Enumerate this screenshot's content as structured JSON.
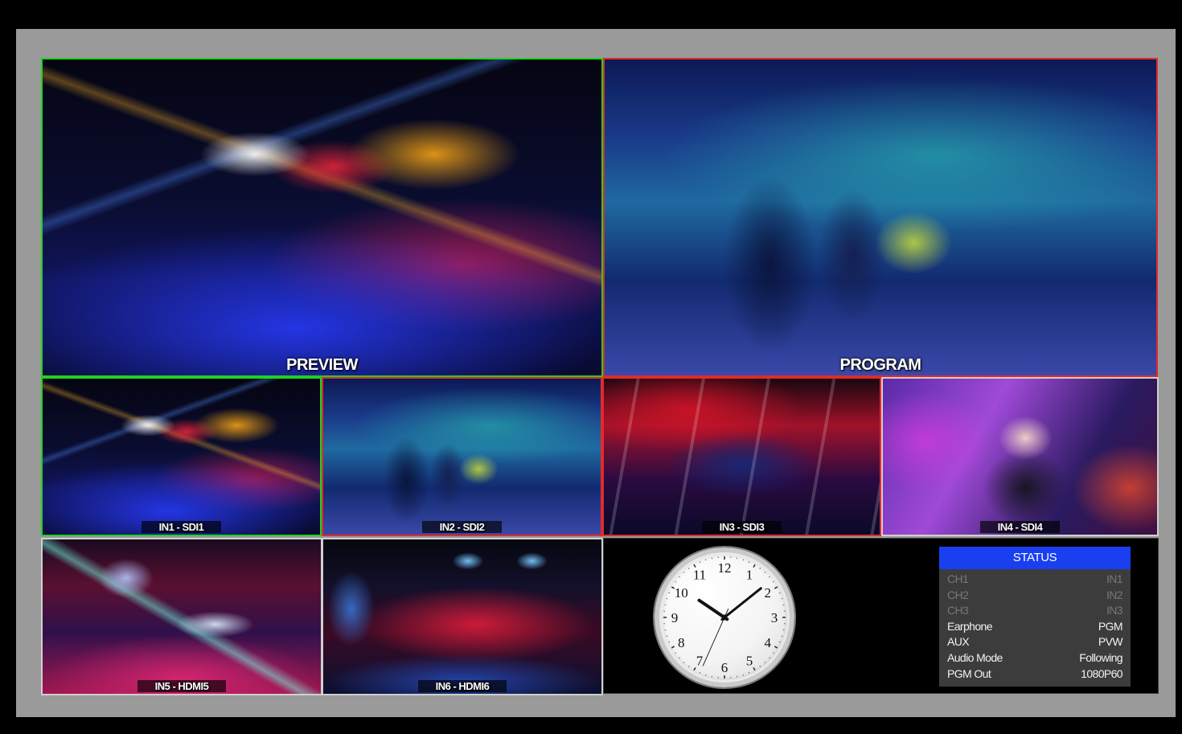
{
  "preview": {
    "label": "PREVIEW"
  },
  "program": {
    "label": "PROGRAM"
  },
  "inputs": [
    {
      "label": "IN1 - SDI1"
    },
    {
      "label": "IN2 - SDI2"
    },
    {
      "label": "IN3 - SDI3"
    },
    {
      "label": "IN4 - SDI4"
    },
    {
      "label": "IN5 - HDMI5"
    },
    {
      "label": "IN6 - HDMI6"
    }
  ],
  "clock": {
    "numerals": [
      "12",
      "1",
      "2",
      "3",
      "4",
      "5",
      "6",
      "7",
      "8",
      "9",
      "10",
      "11"
    ],
    "hour": 10,
    "minute": 8,
    "second": 34
  },
  "status": {
    "title": "STATUS",
    "rows": [
      {
        "key": "CH1",
        "value": "IN1",
        "active": false
      },
      {
        "key": "CH2",
        "value": "IN2",
        "active": false
      },
      {
        "key": "CH3",
        "value": "IN3",
        "active": false
      },
      {
        "key": "Earphone",
        "value": "PGM",
        "active": true
      },
      {
        "key": "AUX",
        "value": "PVW",
        "active": true
      },
      {
        "key": "Audio Mode",
        "value": "Following",
        "active": true
      },
      {
        "key": "PGM Out",
        "value": "1080P60",
        "active": true
      }
    ]
  },
  "colors": {
    "preview_tally": "#1fd21f",
    "program_tally": "#e22a2a",
    "status_header": "#1a3ff0"
  }
}
